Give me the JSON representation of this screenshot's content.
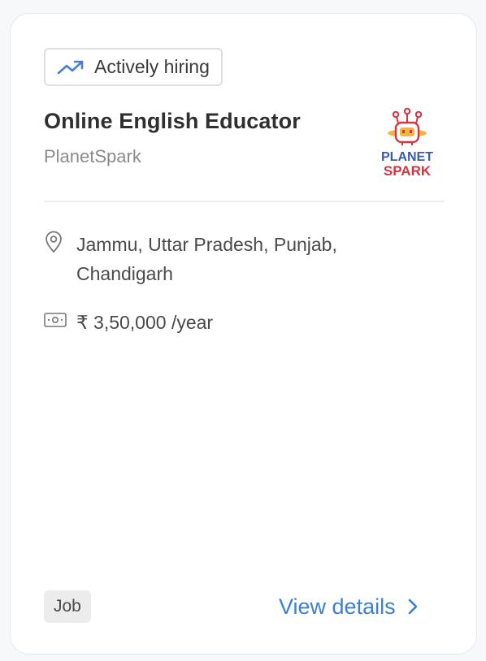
{
  "badge": {
    "label": "Actively hiring",
    "icon": "trending-up-icon"
  },
  "job": {
    "title": "Online English Educator",
    "company": "PlanetSpark",
    "location": "Jammu, Uttar Pradesh, Punjab, Chandigarh",
    "salary": "₹ 3,50,000 /year"
  },
  "logo": {
    "line1": "PLANET",
    "line2": "SPARK"
  },
  "tag": {
    "label": "Job"
  },
  "actions": {
    "view_details": "View details"
  },
  "colors": {
    "accent": "#3d7fd3",
    "badge_icon": "#4a7fd6",
    "logo_blue": "#3b5bab",
    "logo_red": "#d6343f",
    "logo_yellow": "#f2b640"
  }
}
